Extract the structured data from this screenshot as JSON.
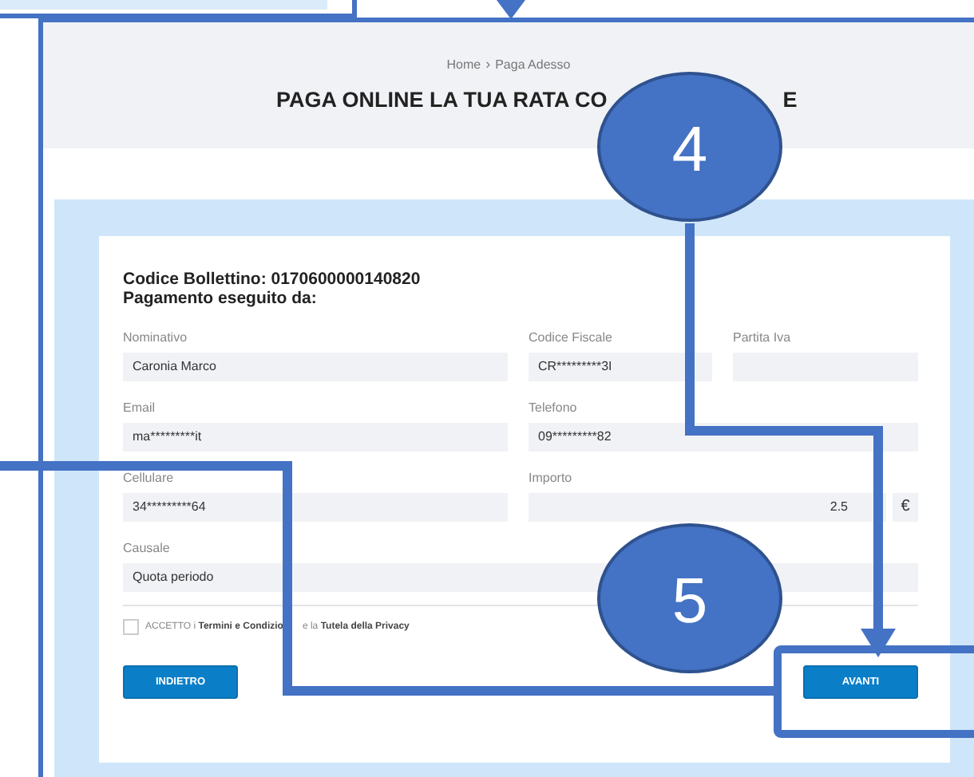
{
  "page": {
    "breadcrumb": [
      "Home",
      "Paga Adesso"
    ],
    "separator": "›",
    "title": "PAGA ONLINE LA TUA RATA CO",
    "title_tail": "E"
  },
  "form": {
    "code_line": "Codice Bollettino: 0170600000140820",
    "paid_by": "Pagamento eseguito da:",
    "fields": [
      {
        "kind": "single",
        "label": "Nominativo",
        "value": "Caronia Marco"
      },
      {
        "kind": "single",
        "label": "Codice Fiscale",
        "value": "CR*********3I"
      },
      {
        "kind": "single",
        "label": "Partita Iva"
      },
      {
        "kind": "single",
        "label": "Email",
        "value": "ma*********it"
      },
      {
        "kind": "double",
        "label": "Telefono",
        "value": "09*********82"
      },
      {
        "kind": "single",
        "label": "Cellulare",
        "value": "34*********64"
      },
      {
        "kind": "amount",
        "label": "Importo",
        "value": "2.5",
        "suffix": "€"
      },
      {
        "kind": "full",
        "label": "Causale",
        "value": "Quota periodo"
      }
    ],
    "consent": {
      "checked": false,
      "parts": [
        "ACCETTO i **Termini e Condizio**",
        "e la **Tutela della Privacy**"
      ]
    },
    "buttons": [
      {
        "label": "INDIETRO"
      },
      {
        "label": "AVANTI"
      }
    ]
  },
  "annotations": {
    "markers": [
      {
        "label": "4"
      },
      {
        "label": "5"
      }
    ]
  }
}
